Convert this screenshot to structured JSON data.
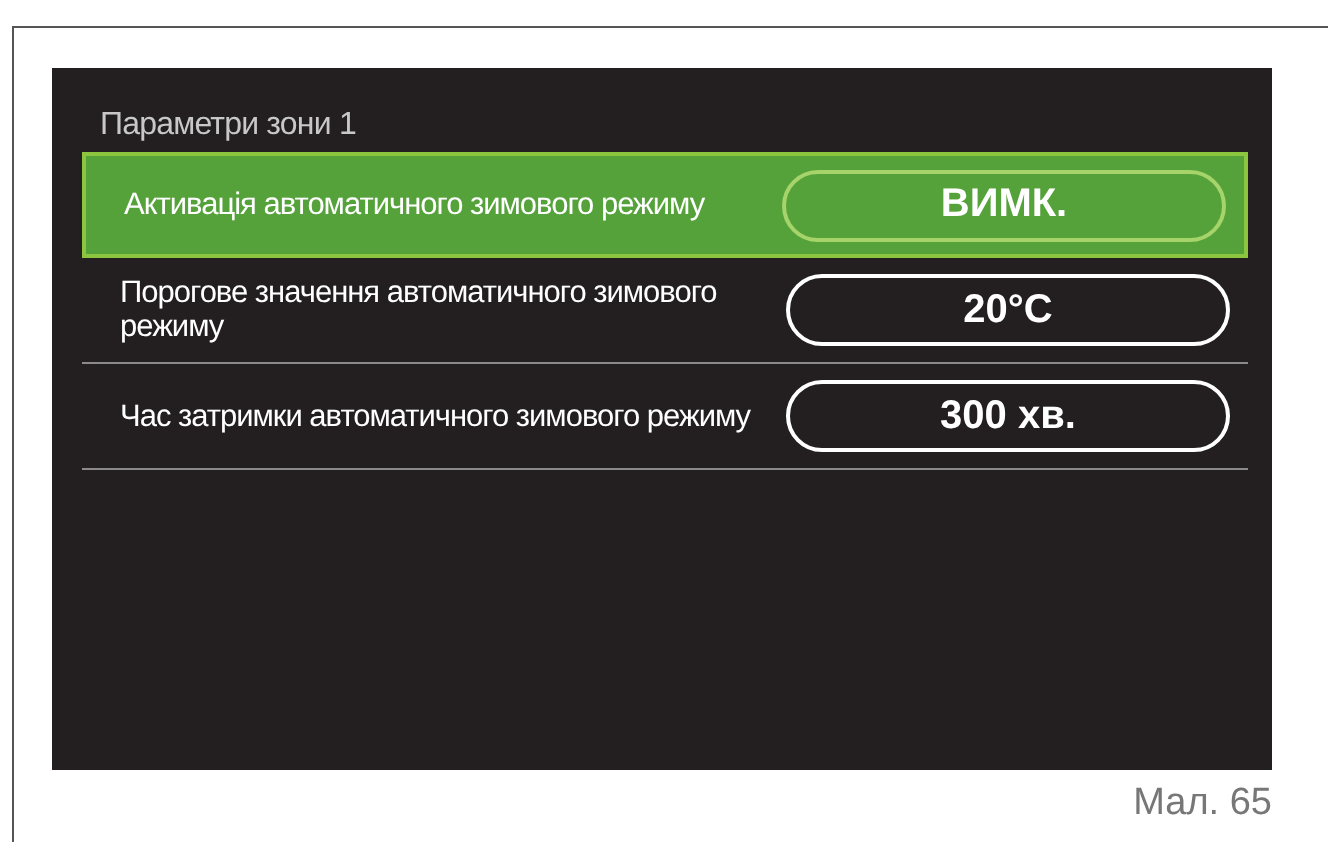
{
  "screen": {
    "title": "Параметри зони 1",
    "rows": [
      {
        "label": "Активація автоматичного зимового режиму",
        "value": "ВИМК.",
        "selected": true
      },
      {
        "label": "Порогове значення автоматичного зимового режиму",
        "value": "20°C",
        "selected": false
      },
      {
        "label": "Час затримки автоматичного зимового режиму",
        "value": "300 хв.",
        "selected": false
      }
    ]
  },
  "caption": "Мал. 65"
}
